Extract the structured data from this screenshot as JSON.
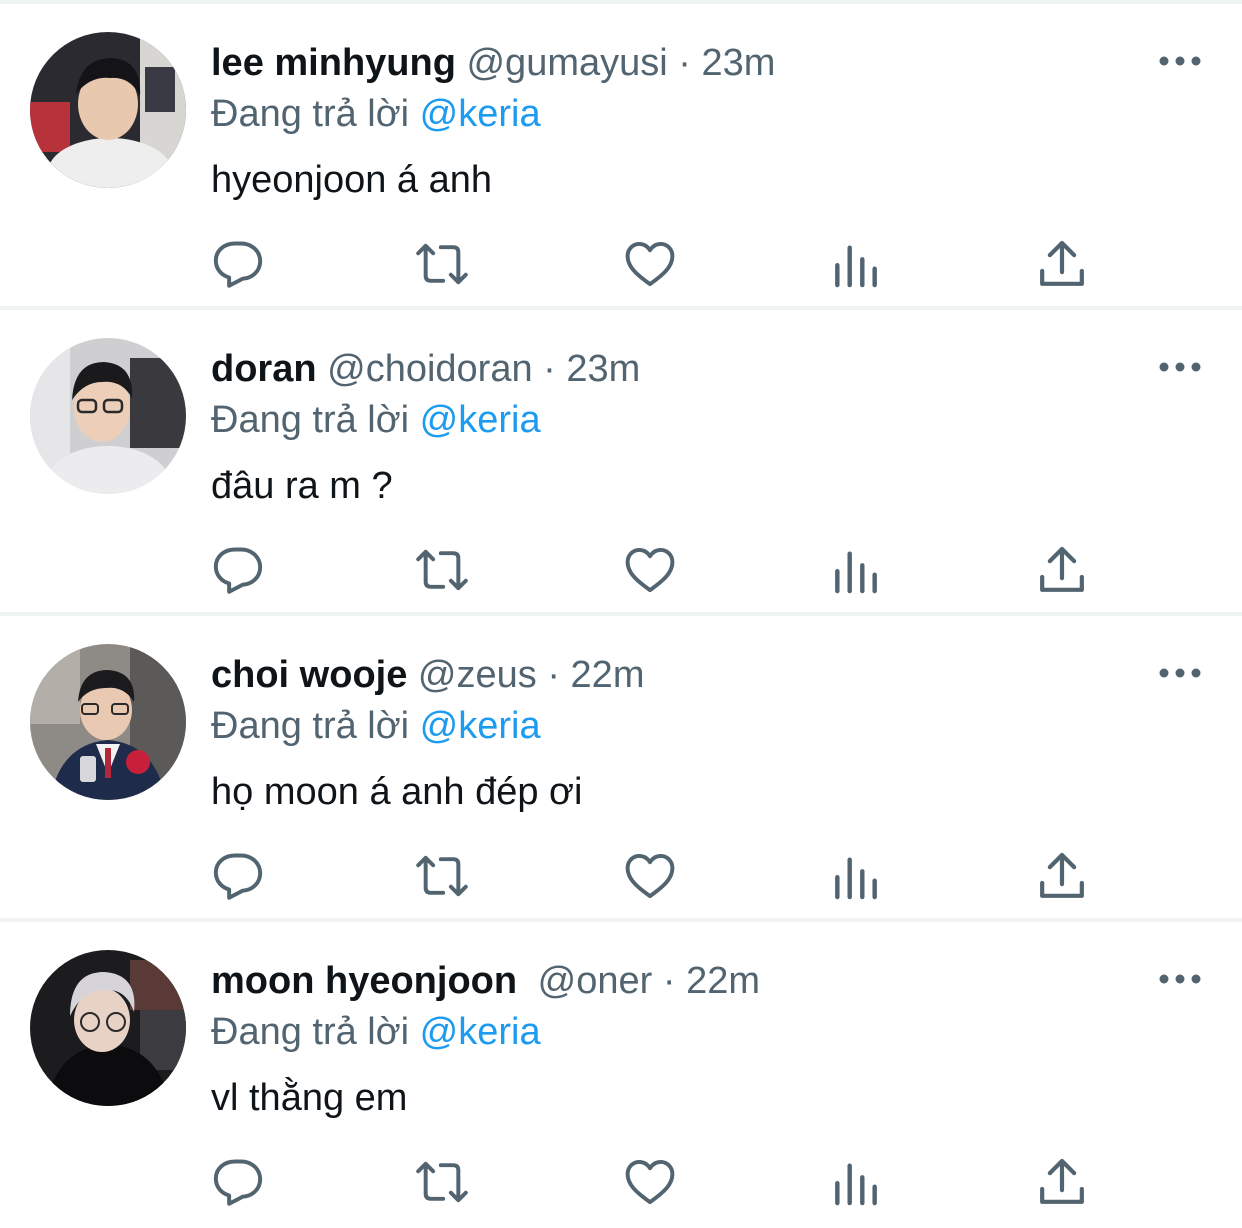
{
  "reply_prefix": "Đang trả lời",
  "tweets": [
    {
      "name": "lee minhyung",
      "handle": "@gumayusi",
      "separator": "·",
      "time": "23m",
      "reply_to": "@keria",
      "text": "hyeonjoon á anh",
      "avatar": "avatar-lee-minhyung"
    },
    {
      "name": "doran",
      "handle": "@choidoran",
      "separator": "·",
      "time": "23m",
      "reply_to": "@keria",
      "text": "đâu ra m ?",
      "avatar": "avatar-doran"
    },
    {
      "name": "choi wooje",
      "handle": "@zeus",
      "separator": "·",
      "time": "22m",
      "reply_to": "@keria",
      "text": "họ moon á anh đép ơi",
      "avatar": "avatar-choi-wooje"
    },
    {
      "name": "moon hyeonjoon",
      "handle": "@oner",
      "separator": "·",
      "time": "22m",
      "reply_to": "@keria",
      "text": "vl thằng em",
      "avatar": "avatar-moon-hyeonjoon"
    }
  ],
  "icons": {
    "reply": "reply-icon",
    "retweet": "retweet-icon",
    "like": "heart-icon",
    "views": "views-icon",
    "share": "share-icon",
    "more": "more-options-icon"
  },
  "colors": {
    "text_primary": "#0f1419",
    "text_secondary": "#536471",
    "mention": "#1d9bf0",
    "divider": "#eff3f4",
    "icon": "#536471"
  }
}
